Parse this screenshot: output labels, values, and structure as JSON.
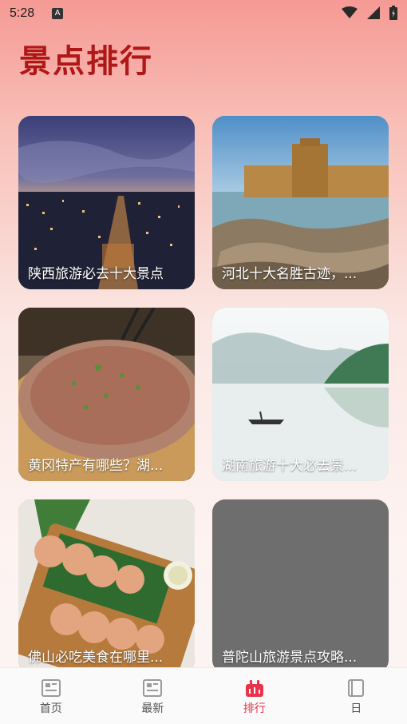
{
  "status_bar": {
    "time": "5:28",
    "notification_badge": "A"
  },
  "page": {
    "title": "景点排行"
  },
  "cards": [
    {
      "caption": "陕西旅游必去十大景点",
      "scene": "city-night"
    },
    {
      "caption": "河北十大名胜古迹，...",
      "scene": "great-wall"
    },
    {
      "caption": "黄冈特产有哪些？湖...",
      "scene": "steamed-dish"
    },
    {
      "caption": "湖南旅游十大必去景...",
      "scene": "misty-lake"
    },
    {
      "caption": "佛山必吃美食在哪里...",
      "scene": "shrimp-cakes"
    },
    {
      "caption": "普陀山旅游景点攻略...",
      "scene": "placeholder-gray"
    }
  ],
  "bottom_nav": {
    "active_color": "#e8334a",
    "items": [
      {
        "label": "首页",
        "icon": "news-icon",
        "active": false
      },
      {
        "label": "最新",
        "icon": "news-icon",
        "active": false
      },
      {
        "label": "排行",
        "icon": "ranking-icon",
        "active": true
      },
      {
        "label": "日",
        "icon": "notebook-icon",
        "active": false
      }
    ]
  }
}
